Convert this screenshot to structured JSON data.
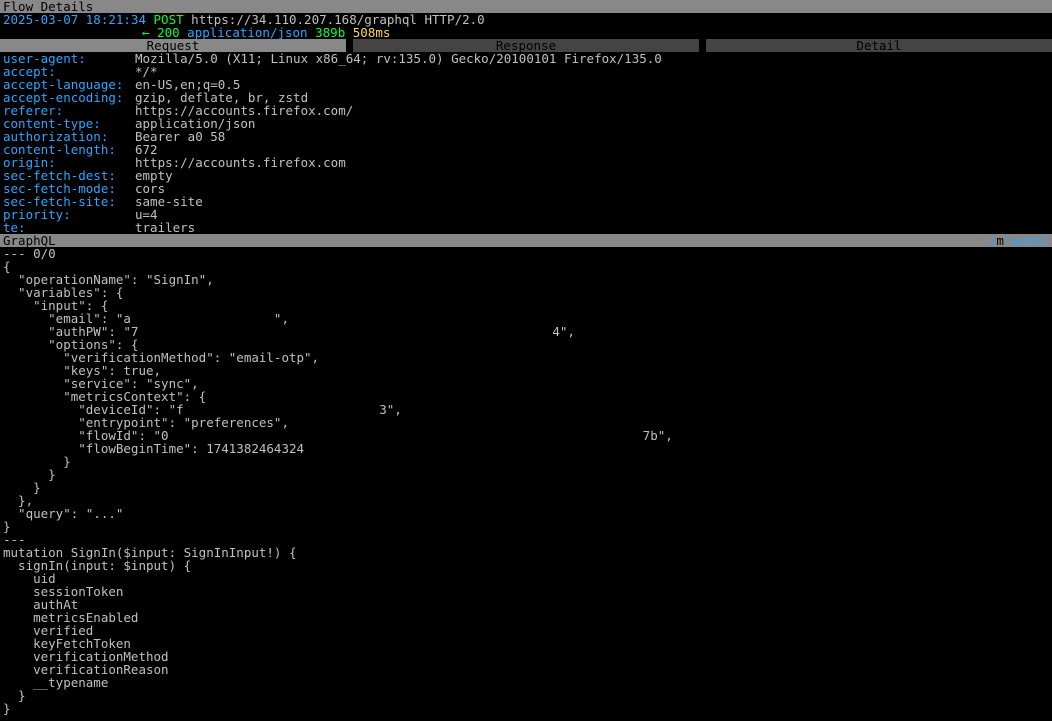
{
  "title": "Flow Details",
  "summary": {
    "timestamp": "2025-03-07 18:21:34",
    "method": "POST",
    "url": "https://34.110.207.168/graphql",
    "http_version": "HTTP/2.0",
    "response_arrow": " ← ",
    "status": "200",
    "content_type": "application/json",
    "size": "389b",
    "time": "508ms"
  },
  "tabs": {
    "request": "Request",
    "response": "Response",
    "detail": "Detail"
  },
  "headers": [
    {
      "k": "user-agent:",
      "v": "Mozilla/5.0 (X11; Linux x86_64; rv:135.0) Gecko/20100101 Firefox/135.0"
    },
    {
      "k": "accept:",
      "v": "*/*"
    },
    {
      "k": "accept-language:",
      "v": "en-US,en;q=0.5"
    },
    {
      "k": "accept-encoding:",
      "v": "gzip, deflate, br, zstd"
    },
    {
      "k": "referer:",
      "v": "https://accounts.firefox.com/"
    },
    {
      "k": "content-type:",
      "v": "application/json"
    },
    {
      "k": "authorization:",
      "v": "Bearer a0                                              58"
    },
    {
      "k": "content-length:",
      "v": "672"
    },
    {
      "k": "origin:",
      "v": "https://accounts.firefox.com"
    },
    {
      "k": "sec-fetch-dest:",
      "v": "empty"
    },
    {
      "k": "sec-fetch-mode:",
      "v": "cors"
    },
    {
      "k": "sec-fetch-site:",
      "v": "same-site"
    },
    {
      "k": "priority:",
      "v": "u=4"
    },
    {
      "k": "te:",
      "v": "trailers"
    }
  ],
  "section": {
    "label": "GraphQL",
    "mode_pre": "[",
    "mode_key": "m",
    "mode_post": ":auto]"
  },
  "body": {
    "search": "--- 0/0",
    "json_part": "{\n  \"operationName\": \"SignIn\",\n  \"variables\": {\n    \"input\": {\n      \"email\": \"a                   \",\n      \"authPW\": \"7                                                       4\",\n      \"options\": {\n        \"verificationMethod\": \"email-otp\",\n        \"keys\": true,\n        \"service\": \"sync\",\n        \"metricsContext\": {\n          \"deviceId\": \"f                          3\",\n          \"entrypoint\": \"preferences\",\n          \"flowId\": \"0                                                               7b\",\n          \"flowBeginTime\": 1741382464324\n        }\n      }\n    }\n  },\n  \"query\": \"...\"\n}\n---\nmutation SignIn($input: SignInInput!) {\n  signIn(input: $input) {\n    uid\n    sessionToken\n    authAt\n    metricsEnabled\n    verified\n    keyFetchToken\n    verificationMethod\n    verificationReason\n    __typename\n  }\n}"
  }
}
